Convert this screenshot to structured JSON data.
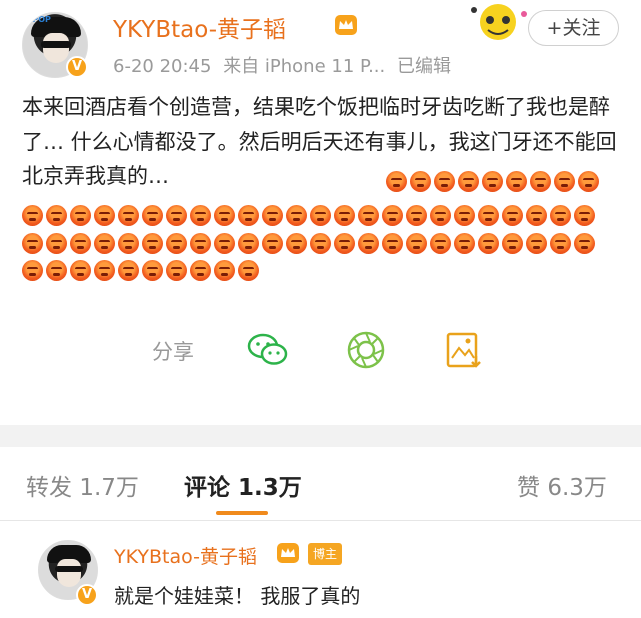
{
  "header": {
    "username": "YKYBtao-黄子韬",
    "date": "6-20 20:45",
    "source": "来自 iPhone 11 P...",
    "edited": "已编辑",
    "follow_label": "+关注",
    "avatar_tag": "C-POP"
  },
  "post": {
    "text": "本来回酒店看个创造营，结果吃个饭把临时牙齿吃断了我也是醉了… 什么心情都没了。然后明后天还有事儿，我这门牙还不能回北京弄我真的…",
    "emoji_name": "angry-face-emoji",
    "emoji_counts": {
      "line_3": 9,
      "line_4": 24,
      "line_5": 24,
      "line_6": 10
    }
  },
  "share": {
    "label": "分享",
    "targets": [
      "wechat-icon",
      "moments-icon",
      "save-image-icon"
    ],
    "colors": {
      "wechat": "#2db34a",
      "moments": "#7dc24a",
      "save": "#e9a21b"
    }
  },
  "tabs": [
    {
      "label": "转发",
      "count": "1.7万",
      "active": false
    },
    {
      "label": "评论",
      "count": "1.3万",
      "active": true
    },
    {
      "label": "赞",
      "count": "6.3万",
      "active": false
    }
  ],
  "comment": {
    "username": "YKYBtao-黄子韬",
    "badge": "博主",
    "text": "就是个娃娃菜！ 我服了真的"
  },
  "colors": {
    "accent": "#e8711d",
    "underline": "#f08a1c",
    "vip": "#f7a21b"
  }
}
